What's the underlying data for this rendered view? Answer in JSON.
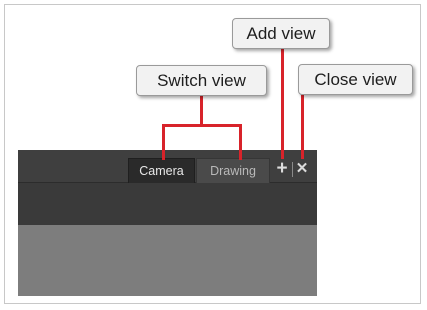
{
  "callouts": {
    "switch_view": "Switch view",
    "add_view": "Add view",
    "close_view": "Close view"
  },
  "tabs": [
    {
      "label": "Camera",
      "active": true
    },
    {
      "label": "Drawing",
      "active": false
    }
  ],
  "icons": {
    "add": "+",
    "close": "✕"
  },
  "colors": {
    "leader_red": "#d8232a",
    "tab_bar": "#3f3f3f",
    "active_tab": "#2a2a2a",
    "view_area": "#7d7d7d"
  }
}
